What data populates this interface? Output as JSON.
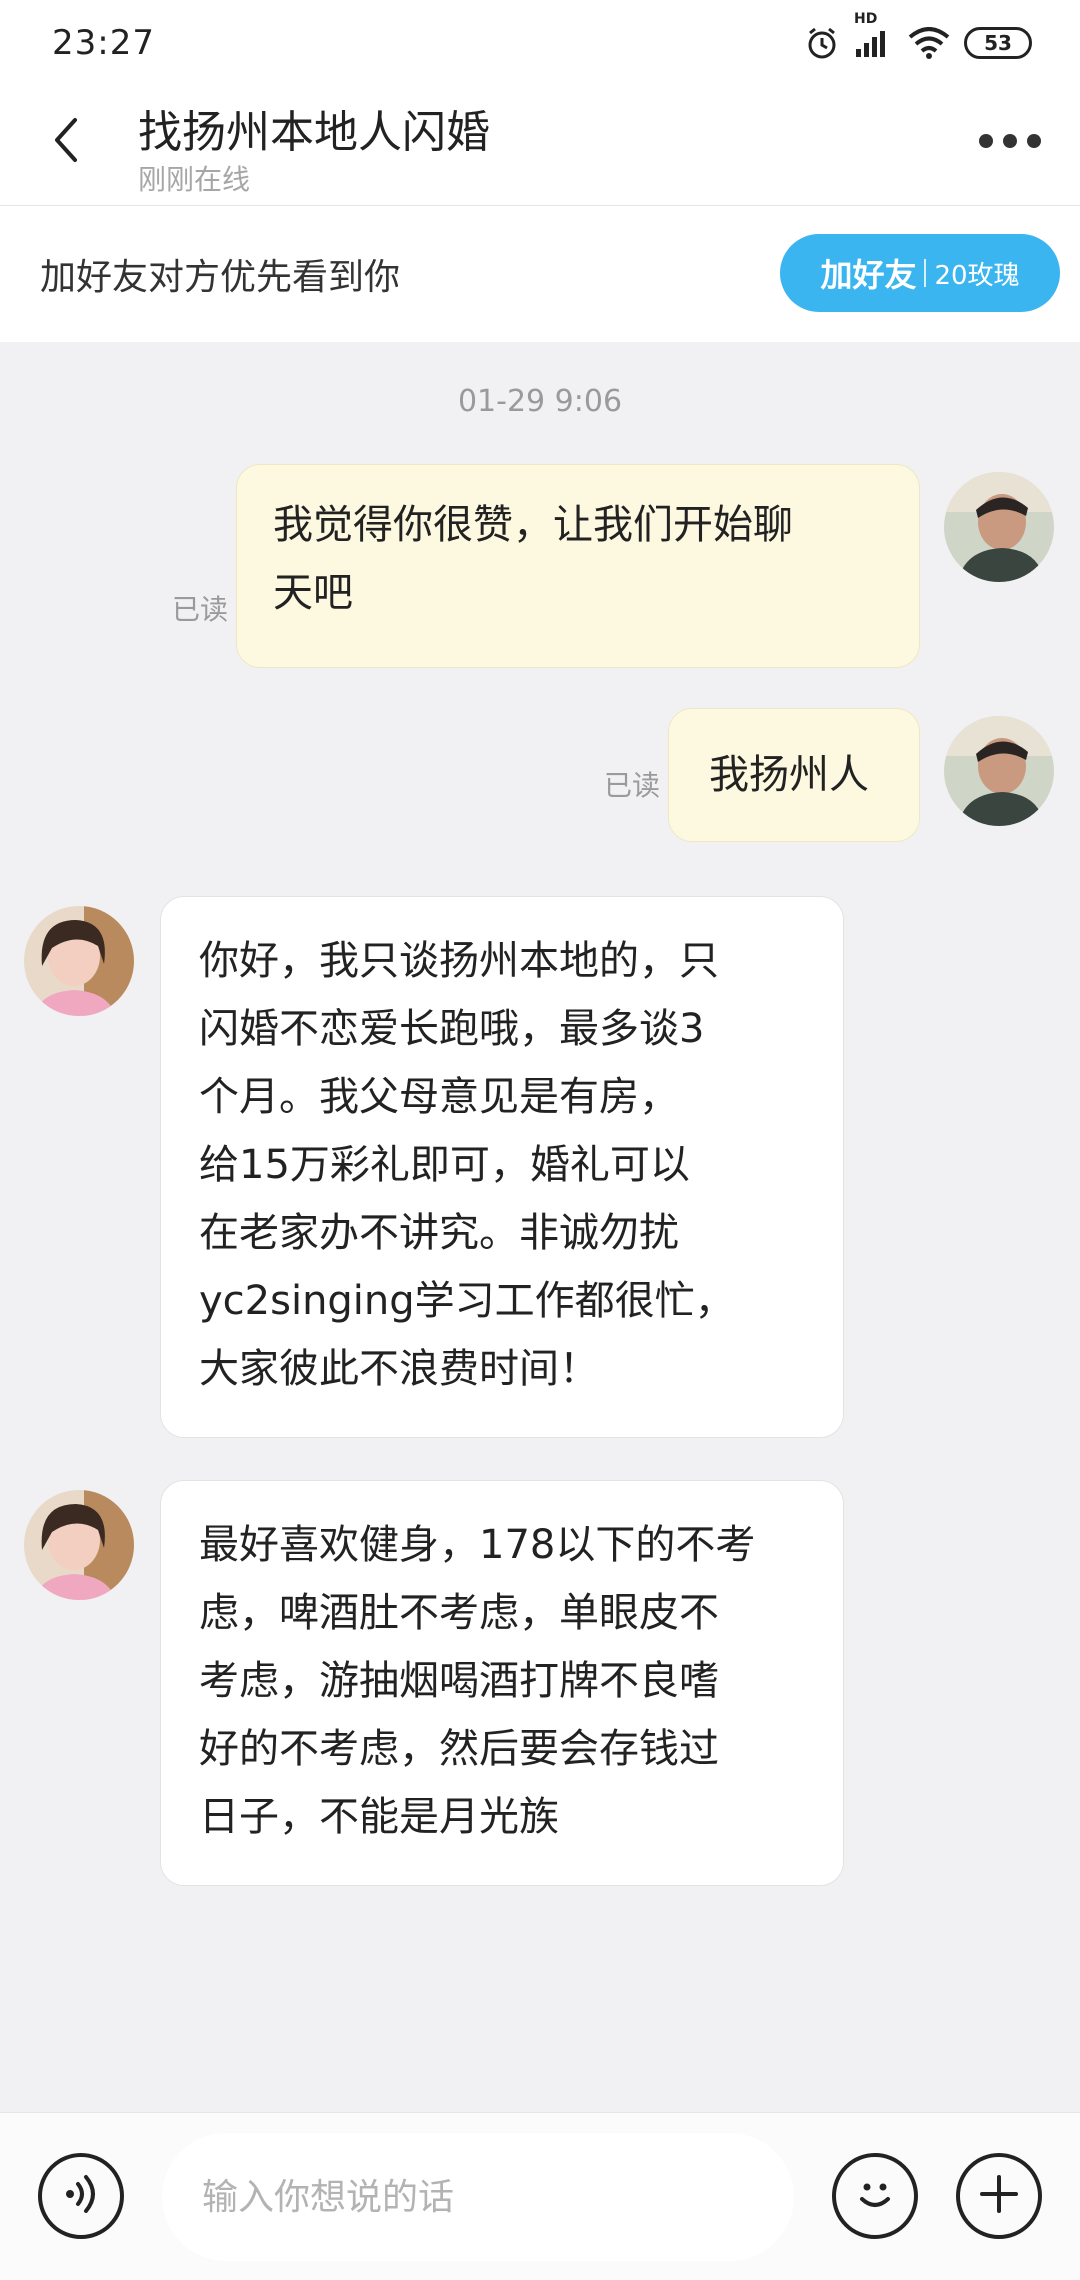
{
  "status_bar": {
    "time": "23:27",
    "signal_label": "HD",
    "battery": "53",
    "icons": [
      "alarm-icon",
      "signal-icon",
      "wifi-icon",
      "battery-icon"
    ]
  },
  "header": {
    "title": "找扬州本地人闪婚",
    "subtitle": "刚刚在线",
    "back_icon": "chevron-left-icon",
    "more_icon": "more-dots-icon"
  },
  "friend_banner": {
    "text": "加好友对方优先看到你",
    "button_label": "加好友",
    "button_cost": "20玫瑰",
    "button_color": "#3ab5ef"
  },
  "chat": {
    "timestamp": "01-29 9:06",
    "messages": [
      {
        "direction": "out",
        "status": "已读",
        "text": "我觉得你很赞，让我们开始聊\n天吧"
      },
      {
        "direction": "out",
        "status": "已读",
        "text": "我扬州人"
      },
      {
        "direction": "in",
        "text": "你好，我只谈扬州本地的，只\n闪婚不恋爱长跑哦，最多谈3\n个月。我父母意见是有房，\n给15万彩礼即可，婚礼可以\n在老家办不讲究。非诚勿扰\nyc2singing学习工作都很忙，\n大家彼此不浪费时间！"
      },
      {
        "direction": "in",
        "text": "最好喜欢健身，178以下的不考\n虑，啤酒肚不考虑，单眼皮不\n考虑，游抽烟喝酒打牌不良嗜\n好的不考虑，然后要会存钱过\n日子，不能是月光族"
      }
    ]
  },
  "input_bar": {
    "placeholder": "输入你想说的话",
    "value": "",
    "icons": [
      "voice-icon",
      "emoji-icon",
      "plus-icon"
    ]
  },
  "colors": {
    "outgoing_bubble": "#fdf8e0",
    "incoming_bubble": "#ffffff",
    "chat_background": "#f1f1f3"
  }
}
